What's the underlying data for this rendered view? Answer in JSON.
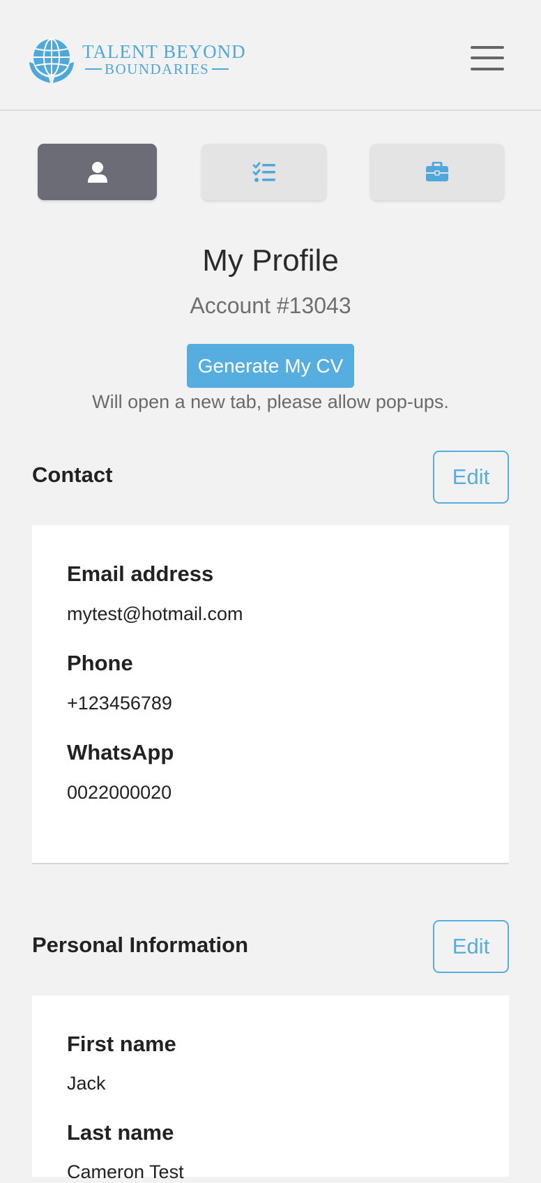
{
  "header": {
    "logo_line1": "TALENT BEYOND",
    "logo_line2": "BOUNDARIES",
    "brand_color": "#4fa8dc",
    "menu_icon": "hamburger-menu-icon"
  },
  "tabs": [
    {
      "icon": "user-icon",
      "active": true
    },
    {
      "icon": "checklist-icon",
      "active": false
    },
    {
      "icon": "briefcase-icon",
      "active": false
    }
  ],
  "profile": {
    "title": "My Profile",
    "account": "Account #13043",
    "generate_cv_label": "Generate My CV",
    "generate_cv_note": "Will open a new tab, please allow pop-ups."
  },
  "contact": {
    "title": "Contact",
    "edit_label": "Edit",
    "fields": [
      {
        "label": "Email address",
        "value": "mytest@hotmail.com"
      },
      {
        "label": "Phone",
        "value": "+123456789"
      },
      {
        "label": "WhatsApp",
        "value": "0022000020"
      }
    ]
  },
  "personal": {
    "title": "Personal Information",
    "edit_label": "Edit",
    "fields": [
      {
        "label": "First name",
        "value": "Jack"
      },
      {
        "label": "Last name",
        "value": "Cameron Test"
      }
    ]
  },
  "colors": {
    "accent": "#55ade0",
    "active_tab": "#6b6c75",
    "background": "#f2f2f2"
  }
}
